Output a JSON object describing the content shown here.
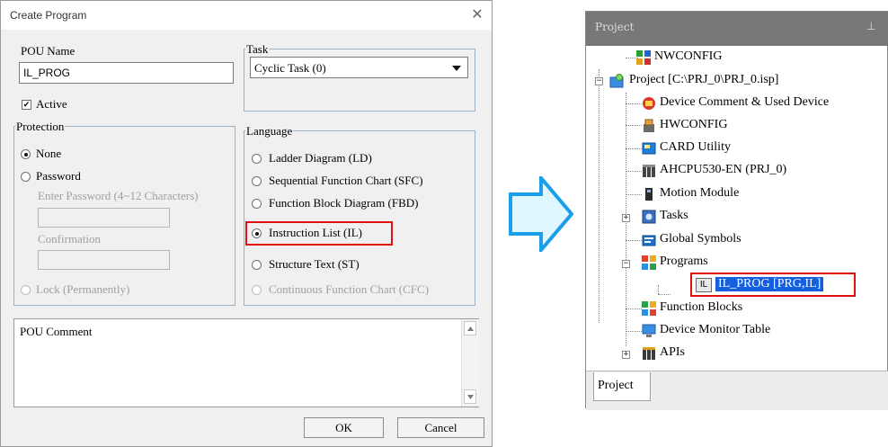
{
  "dialog": {
    "title": "Create Program",
    "close_glyph": "✕",
    "pou_name_label": "POU Name",
    "pou_name_value": "IL_PROG",
    "active_label": "Active",
    "active_checked_glyph": "✔",
    "task_label": "Task",
    "task_value": "Cyclic Task (0)",
    "protection": {
      "label": "Protection",
      "none": "None",
      "password": "Password",
      "enter_password": "Enter Password (4~12 Characters)",
      "confirmation": "Confirmation",
      "lock": "Lock (Permanently)"
    },
    "language": {
      "label": "Language",
      "options": [
        "Ladder Diagram (LD)",
        "Sequential Function Chart (SFC)",
        "Function Block Diagram (FBD)",
        "Instruction List (IL)",
        "Structure Text (ST)",
        "Continuous Function Chart (CFC)"
      ],
      "selected": "Instruction List (IL)"
    },
    "comment_label": "POU Comment",
    "ok_label": "OK",
    "cancel_label": "Cancel"
  },
  "project_panel": {
    "title": "Project",
    "pin_glyph": "⊥",
    "tree": {
      "nwconfig": "NWCONFIG",
      "project": "Project [C:\\PRJ_0\\PRJ_0.isp]",
      "device_comment": "Device Comment & Used Device",
      "hwconfig": "HWCONFIG",
      "card_utility": "CARD Utility",
      "ahcpu": "AHCPU530-EN  (PRJ_0)",
      "motion_module": "Motion Module",
      "tasks": "Tasks",
      "global_symbols": "Global Symbols",
      "programs": "Programs",
      "il_badge": "IL",
      "il_prog": "IL_PROG [PRG,IL]",
      "function_blocks": "Function Blocks",
      "device_monitor_table": "Device Monitor Table",
      "apis": "APIs"
    },
    "tab": "Project"
  },
  "colors": {
    "highlight_border": "#e01010",
    "arrow_fill": "#dff7ff",
    "arrow_stroke": "#1a9fe8",
    "selection": "#1560e0"
  }
}
